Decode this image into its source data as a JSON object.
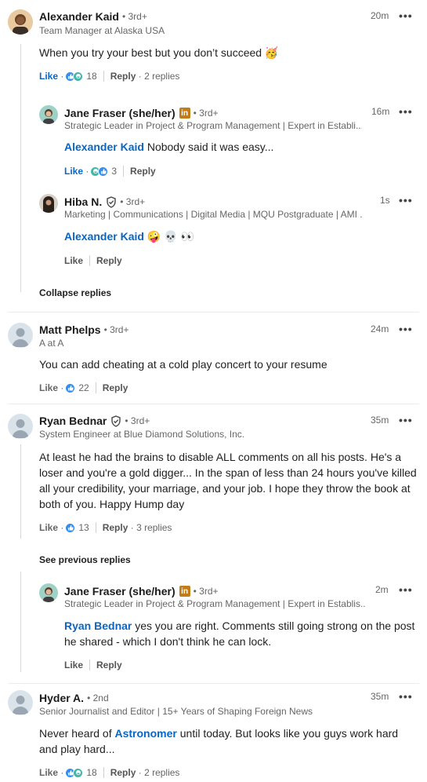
{
  "comments": [
    {
      "name": "Alexander Kaid",
      "degree": "• 3rd+",
      "headline": "Team Manager at Alaska USA",
      "time": "20m",
      "text": "When you try your best but you don’t succeed 🥳",
      "like": "Like",
      "reaction_count": "18",
      "reply": "Reply",
      "replies": "2 replies"
    },
    {
      "name": "Jane Fraser (she/her)",
      "degree": "• 3rd+",
      "headline": "Strategic Leader in Project & Program Management | Expert in Establi...",
      "time": "16m",
      "mention": "Alexander Kaid",
      "text": " Nobody said it was easy...",
      "like": "Like",
      "reaction_count": "3",
      "reply": "Reply"
    },
    {
      "name": "Hiba N.",
      "degree": "• 3rd+",
      "headline": "Marketing | Communications | Digital Media | MQU Postgraduate | AMI ...",
      "time": "1s",
      "mention": "Alexander Kaid",
      "text": " 🤪 💀 👀",
      "like": "Like",
      "reply": "Reply"
    },
    {
      "name": "Matt Phelps",
      "degree": "• 3rd+",
      "headline": "A at A",
      "time": "24m",
      "text": "You can add cheating at a cold play concert to your resume",
      "like": "Like",
      "reaction_count": "22",
      "reply": "Reply"
    },
    {
      "name": "Ryan Bednar",
      "degree": "• 3rd+",
      "headline": "System Engineer at Blue Diamond Solutions, Inc.",
      "time": "35m",
      "text": "At least he had the brains to disable ALL comments on all his posts. He's a loser and you're a gold digger... In the span of less than 24 hours you've killed all your credibility, your marriage, and your job. I hope they throw the book at both of you. Happy Hump day",
      "like": "Like",
      "reaction_count": "13",
      "reply": "Reply",
      "replies": "3 replies"
    },
    {
      "name": "Jane Fraser (she/her)",
      "degree": "• 3rd+",
      "headline": "Strategic Leader in Project & Program Management | Expert in Establis...",
      "time": "2m",
      "mention": "Ryan Bednar",
      "text": " yes you are right. Comments still going strong on the post he shared - which I don't think he can lock.",
      "like": "Like",
      "reply": "Reply"
    },
    {
      "name": "Hyder A.",
      "degree": "• 2nd",
      "headline": "Senior Journalist and Editor | 15+ Years of Shaping Foreign News",
      "time": "35m",
      "text_before": "Never heard of ",
      "mention": "Astronomer",
      "text": " until today. But looks like you guys work hard and play hard...",
      "like": "Like",
      "reaction_count": "18",
      "reply": "Reply",
      "replies": "2 replies"
    }
  ],
  "collapse_replies": "Collapse replies",
  "see_previous_replies": "See previous replies",
  "more_label": "•••",
  "colors": {
    "link": "#0a66c2",
    "muted": "#666666",
    "li_badge": "#c37d16"
  }
}
